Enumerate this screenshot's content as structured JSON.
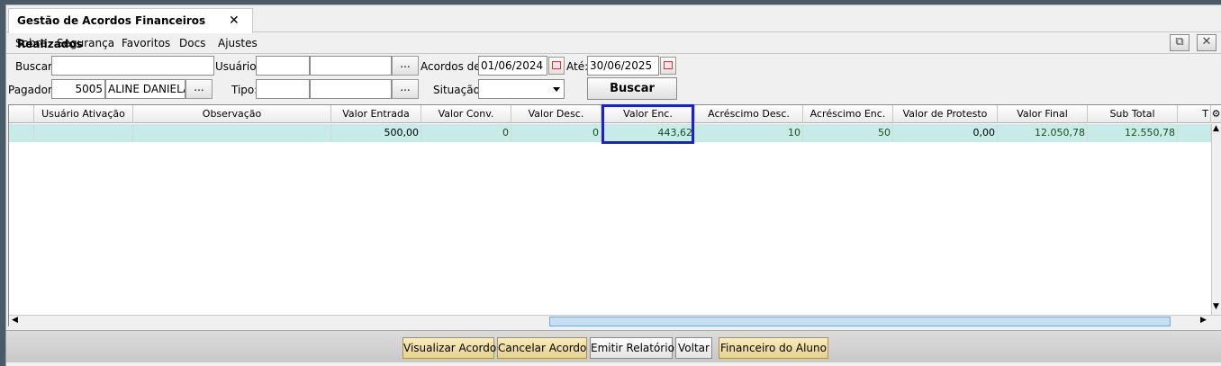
{
  "tab": {
    "title": "Gestão de Acordos Financeiros Realizados",
    "close_glyph": "✕"
  },
  "menu": [
    "Sobre",
    "Segurança",
    "Favoritos",
    "Docs",
    "Ajustes"
  ],
  "toolbar": {
    "popout_icon": "external-window-icon",
    "close_icon": "close-icon",
    "popout_glyph": "⧉",
    "close_glyph": "✕"
  },
  "filters": {
    "buscar_label": "Buscar:",
    "buscar_value": "",
    "usuario_label": "Usuário:",
    "usuario_code": "",
    "usuario_name": "",
    "acordos_de_label": "Acordos de:",
    "acordos_de_value": "01/06/2024",
    "ate_label": "Até:",
    "ate_value": "30/06/2025",
    "pagador_label": "Pagador:",
    "pagador_code": "5005",
    "pagador_name": "ALINE DANIELA",
    "tipo_label": "Tipo:",
    "tipo_code": "",
    "tipo_name": "",
    "situacao_label": "Situação:",
    "situacao_value": "",
    "lookup_glyph": "...",
    "buscar_button": "Buscar"
  },
  "grid": {
    "columns": [
      "Usuário Ativação",
      "Observação",
      "Valor Entrada",
      "Valor Conv.",
      "Valor Desc.",
      "Valor Enc.",
      "Acréscimo Desc.",
      "Acréscimo Enc.",
      "Valor de Protesto",
      "Valor Final",
      "Sub Total",
      "T"
    ],
    "rows": [
      {
        "usuario_ativacao": "",
        "observacao": "",
        "valor_entrada": "500,00",
        "valor_conv": "0",
        "valor_desc": "0",
        "valor_enc": "443,62",
        "acrescimo_desc": "10",
        "acrescimo_enc": "50",
        "valor_protesto": "0,00",
        "valor_final": "12.050,78",
        "sub_total": "12.550,78"
      }
    ],
    "highlighted_column": "Valor Enc."
  },
  "footer": {
    "visualizar": "Visualizar Acordo",
    "cancelar": "Cancelar Acordo",
    "emitir": "Emitir Relatório",
    "voltar": "Voltar",
    "financeiro": "Financeiro do Aluno"
  }
}
